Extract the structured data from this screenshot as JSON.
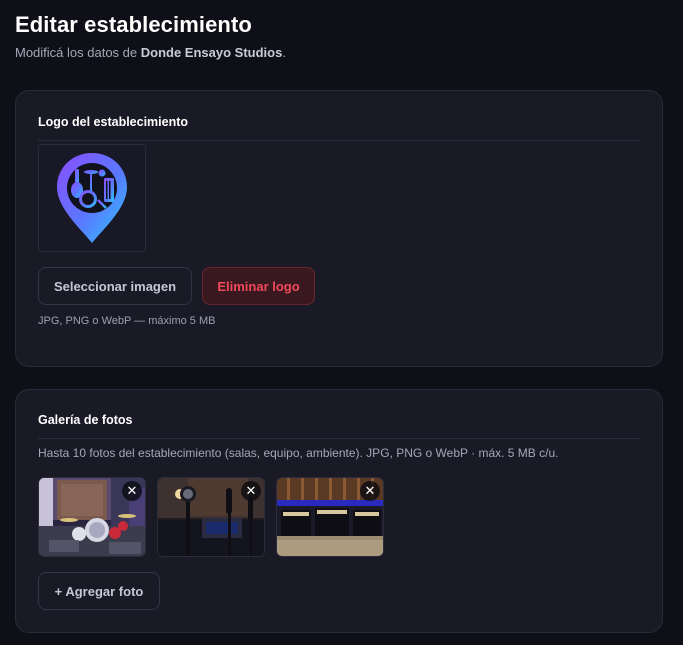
{
  "header": {
    "title": "Editar establecimiento",
    "subtitle_prefix": "Modificá los datos de ",
    "business_name": "Donde Ensayo Studios",
    "subtitle_suffix": "."
  },
  "logo_section": {
    "heading": "Logo del establecimiento",
    "select_button": "Seleccionar imagen",
    "delete_button": "Eliminar logo",
    "hint": "JPG, PNG o WebP — máximo 5 MB"
  },
  "gallery_section": {
    "heading": "Galería de fotos",
    "description": "Hasta 10 fotos del establecimiento (salas, equipo, ambiente). JPG, PNG o WebP · máx. 5 MB c/u.",
    "photos": [
      {
        "subject": "drum-kit-room",
        "remove_glyph": "✕"
      },
      {
        "subject": "microphones-stage",
        "remove_glyph": "✕"
      },
      {
        "subject": "amplifiers-room",
        "remove_glyph": "✕"
      }
    ],
    "add_button": "+ Agregar foto"
  },
  "colors": {
    "background": "#0f0f17",
    "card": "#1a1a26",
    "danger": "#f04a5a",
    "accent_gradient_start": "#7c4dff",
    "accent_gradient_end": "#2ec4ff"
  }
}
